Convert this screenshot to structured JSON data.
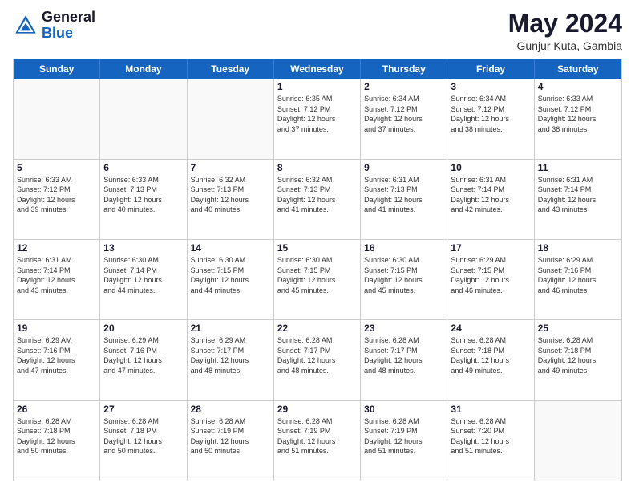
{
  "header": {
    "logo_general": "General",
    "logo_blue": "Blue",
    "month_year": "May 2024",
    "location": "Gunjur Kuta, Gambia"
  },
  "weekdays": [
    "Sunday",
    "Monday",
    "Tuesday",
    "Wednesday",
    "Thursday",
    "Friday",
    "Saturday"
  ],
  "weeks": [
    [
      {
        "day": "",
        "info": ""
      },
      {
        "day": "",
        "info": ""
      },
      {
        "day": "",
        "info": ""
      },
      {
        "day": "1",
        "info": "Sunrise: 6:35 AM\nSunset: 7:12 PM\nDaylight: 12 hours\nand 37 minutes."
      },
      {
        "day": "2",
        "info": "Sunrise: 6:34 AM\nSunset: 7:12 PM\nDaylight: 12 hours\nand 37 minutes."
      },
      {
        "day": "3",
        "info": "Sunrise: 6:34 AM\nSunset: 7:12 PM\nDaylight: 12 hours\nand 38 minutes."
      },
      {
        "day": "4",
        "info": "Sunrise: 6:33 AM\nSunset: 7:12 PM\nDaylight: 12 hours\nand 38 minutes."
      }
    ],
    [
      {
        "day": "5",
        "info": "Sunrise: 6:33 AM\nSunset: 7:12 PM\nDaylight: 12 hours\nand 39 minutes."
      },
      {
        "day": "6",
        "info": "Sunrise: 6:33 AM\nSunset: 7:13 PM\nDaylight: 12 hours\nand 40 minutes."
      },
      {
        "day": "7",
        "info": "Sunrise: 6:32 AM\nSunset: 7:13 PM\nDaylight: 12 hours\nand 40 minutes."
      },
      {
        "day": "8",
        "info": "Sunrise: 6:32 AM\nSunset: 7:13 PM\nDaylight: 12 hours\nand 41 minutes."
      },
      {
        "day": "9",
        "info": "Sunrise: 6:31 AM\nSunset: 7:13 PM\nDaylight: 12 hours\nand 41 minutes."
      },
      {
        "day": "10",
        "info": "Sunrise: 6:31 AM\nSunset: 7:14 PM\nDaylight: 12 hours\nand 42 minutes."
      },
      {
        "day": "11",
        "info": "Sunrise: 6:31 AM\nSunset: 7:14 PM\nDaylight: 12 hours\nand 43 minutes."
      }
    ],
    [
      {
        "day": "12",
        "info": "Sunrise: 6:31 AM\nSunset: 7:14 PM\nDaylight: 12 hours\nand 43 minutes."
      },
      {
        "day": "13",
        "info": "Sunrise: 6:30 AM\nSunset: 7:14 PM\nDaylight: 12 hours\nand 44 minutes."
      },
      {
        "day": "14",
        "info": "Sunrise: 6:30 AM\nSunset: 7:15 PM\nDaylight: 12 hours\nand 44 minutes."
      },
      {
        "day": "15",
        "info": "Sunrise: 6:30 AM\nSunset: 7:15 PM\nDaylight: 12 hours\nand 45 minutes."
      },
      {
        "day": "16",
        "info": "Sunrise: 6:30 AM\nSunset: 7:15 PM\nDaylight: 12 hours\nand 45 minutes."
      },
      {
        "day": "17",
        "info": "Sunrise: 6:29 AM\nSunset: 7:15 PM\nDaylight: 12 hours\nand 46 minutes."
      },
      {
        "day": "18",
        "info": "Sunrise: 6:29 AM\nSunset: 7:16 PM\nDaylight: 12 hours\nand 46 minutes."
      }
    ],
    [
      {
        "day": "19",
        "info": "Sunrise: 6:29 AM\nSunset: 7:16 PM\nDaylight: 12 hours\nand 47 minutes."
      },
      {
        "day": "20",
        "info": "Sunrise: 6:29 AM\nSunset: 7:16 PM\nDaylight: 12 hours\nand 47 minutes."
      },
      {
        "day": "21",
        "info": "Sunrise: 6:29 AM\nSunset: 7:17 PM\nDaylight: 12 hours\nand 48 minutes."
      },
      {
        "day": "22",
        "info": "Sunrise: 6:28 AM\nSunset: 7:17 PM\nDaylight: 12 hours\nand 48 minutes."
      },
      {
        "day": "23",
        "info": "Sunrise: 6:28 AM\nSunset: 7:17 PM\nDaylight: 12 hours\nand 48 minutes."
      },
      {
        "day": "24",
        "info": "Sunrise: 6:28 AM\nSunset: 7:18 PM\nDaylight: 12 hours\nand 49 minutes."
      },
      {
        "day": "25",
        "info": "Sunrise: 6:28 AM\nSunset: 7:18 PM\nDaylight: 12 hours\nand 49 minutes."
      }
    ],
    [
      {
        "day": "26",
        "info": "Sunrise: 6:28 AM\nSunset: 7:18 PM\nDaylight: 12 hours\nand 50 minutes."
      },
      {
        "day": "27",
        "info": "Sunrise: 6:28 AM\nSunset: 7:18 PM\nDaylight: 12 hours\nand 50 minutes."
      },
      {
        "day": "28",
        "info": "Sunrise: 6:28 AM\nSunset: 7:19 PM\nDaylight: 12 hours\nand 50 minutes."
      },
      {
        "day": "29",
        "info": "Sunrise: 6:28 AM\nSunset: 7:19 PM\nDaylight: 12 hours\nand 51 minutes."
      },
      {
        "day": "30",
        "info": "Sunrise: 6:28 AM\nSunset: 7:19 PM\nDaylight: 12 hours\nand 51 minutes."
      },
      {
        "day": "31",
        "info": "Sunrise: 6:28 AM\nSunset: 7:20 PM\nDaylight: 12 hours\nand 51 minutes."
      },
      {
        "day": "",
        "info": ""
      }
    ]
  ]
}
